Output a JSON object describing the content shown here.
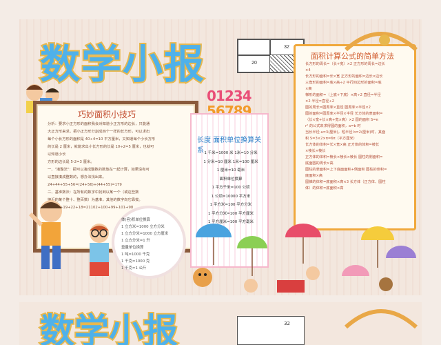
{
  "poster": {
    "title": "数学小报",
    "box": {
      "top_right": "32",
      "bottom_left": "20"
    }
  },
  "tips": {
    "heading": "巧妙面积小技巧",
    "lines": [
      "分析：要求小正方形的面积我会对知道小正方形的边长，只能通",
      "大正方形来求。把小正方形分割成四个一样的长方形，可以求出",
      "每个小长方形的面积是 40÷4=10 平方厘米，又知道每个小长方形",
      "的长是 2 厘米，就能求出小长方形的长是 10÷2=5 厘米，也就可",
      "以知道小长",
      "方形的边长是 5-2=3 厘米。",
      "一、\"凑整法\"：把可以凑成整数的数放在一起计算，如果没有可",
      "以直接凑成整数的，想办法找出来。",
      "24+44+55+56=(24+56)+(44+55)=179",
      "二、基准数法：在所有的数字中找到以某一个（或这些数",
      "接近的某个整十、整百数）为基准，其他的数字向它靠拢。",
      "23+20+19+22+18=21102+100+99+101+98"
    ]
  },
  "formulas": {
    "heading": "面积计算公式的简单方法",
    "lines": [
      "长方形的周长=（长+宽）×2    正方形的周长=边长",
      "×4",
      "长方形的面积=长×宽    正方形的面积=边长×边长",
      "三角形的面积=底×高÷2    平行四边形的面积=底",
      "×高",
      "梯形的面积=（上底+下底）×高÷2    直径=半径",
      "×2    半径=直径÷2",
      "圆的周长=圆周率×直径    圆周率×半径×2",
      "圆的面积=圆周率×半径×半径    长方体的表面积=",
      "（长×宽+长×高+宽×高）×2    圆的面积 S=π",
      "r² 的公式来求得圆的面积，a=b 时",
      "当长半径 a=3(厘米)，短半径 b=2(厘米)时，其面",
      "积 S=3×2×π=6π（平方厘米）",
      "长方体的体积=长×宽×高    正方体的体积=棱长",
      "×棱长×棱长",
      "正方体的体积=棱长×棱长×棱长  圆柱的侧面积=",
      "底面圆的周长×高",
      "圆柱的表面积=上下底面面积+侧面积  圆柱的体积=",
      "底面积×高",
      "圆锥的体积=底面积×高×3  长方体（正方体、圆柱",
      "体）的体积=底面积×高"
    ]
  },
  "units": {
    "digits_row1": "01234",
    "digits_row2": "56789",
    "heading": "长度  面积单位换算关系",
    "lines": [
      "1 千米=1000 米 1米=10 分米",
      "1 分米=10 厘米 1米=100 厘米",
      "1 厘米=10 毫米",
      "面积单位换算",
      "1 平方千米=100 公顷",
      "1 公顷=10000 平方米",
      "1 平方米=100 平方分米",
      "1 平方分米=100 平方厘米",
      "1 平方厘米=100 平方毫米"
    ]
  },
  "cloud": {
    "lines": [
      "体(容)积单位换算",
      "1 立方米=1000 立方分米",
      "1 立方分米=1000 立方厘米",
      "1 立方分米=1 升",
      "重量单位换算",
      "1 吨=1000 千克",
      "1 千克=1000 克",
      "1 千克=1 公斤"
    ]
  },
  "colors": {
    "title_fill": "#4fb1ea",
    "title_stroke": "#e8b84e",
    "frame_brown": "#8a5a3c",
    "frame_orange": "#f0a83c",
    "heading_red": "#c24b2e",
    "heading_blue": "#2b7fc9"
  }
}
